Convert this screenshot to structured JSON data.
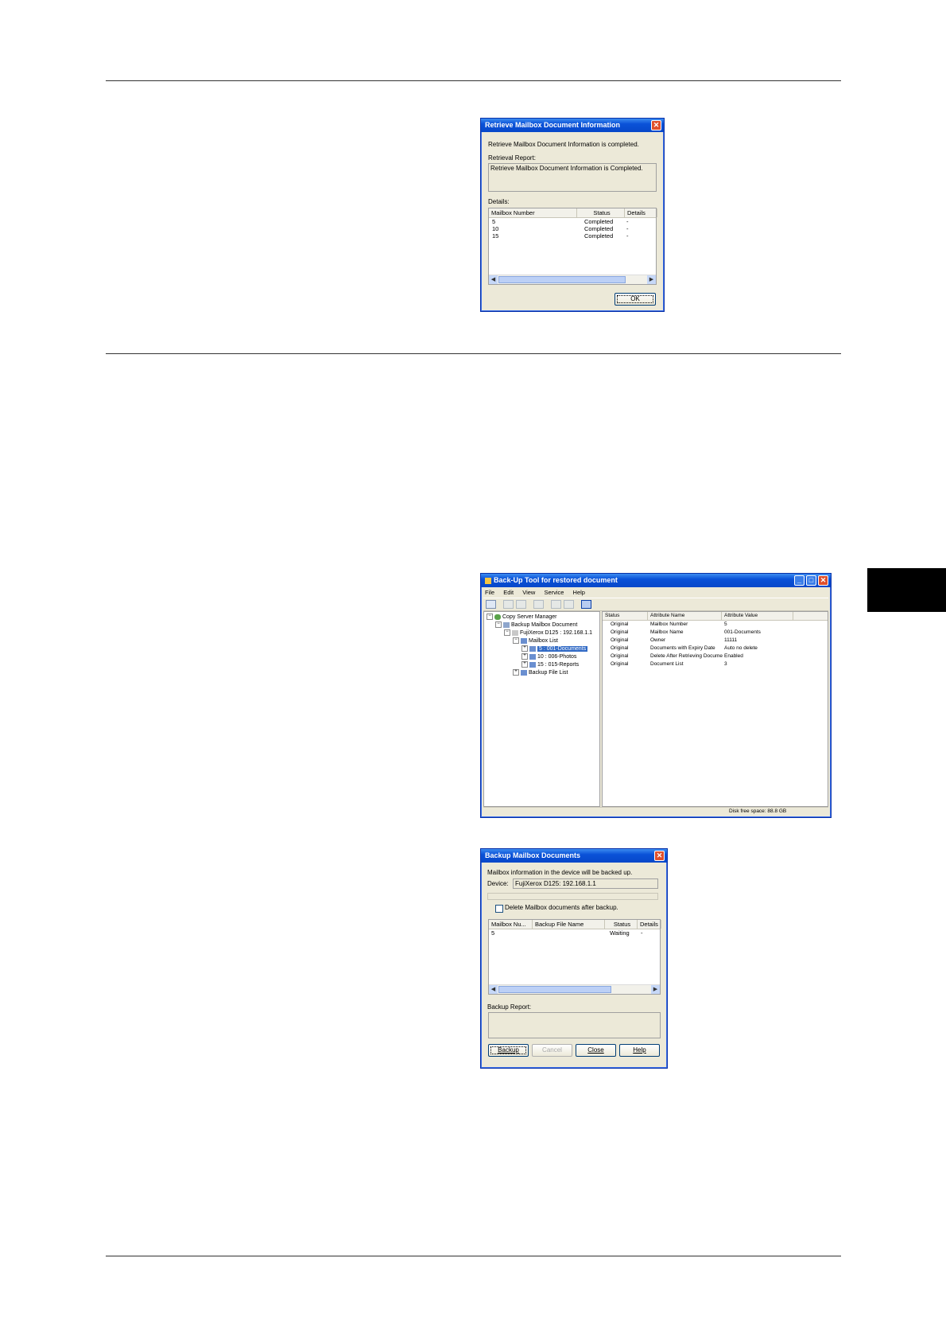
{
  "dialog1": {
    "title": "Retrieve Mailbox Document Information",
    "message": "Retrieve Mailbox Document Information is completed.",
    "report_label": "Retrieval Report:",
    "report_text": "Retrieve Mailbox Document Information is Completed.",
    "details_label": "Details:",
    "columns": [
      "Mailbox Number",
      "Status",
      "Details"
    ],
    "rows": [
      {
        "mailbox": "5",
        "status": "Completed",
        "details": "-"
      },
      {
        "mailbox": "10",
        "status": "Completed",
        "details": "-"
      },
      {
        "mailbox": "15",
        "status": "Completed",
        "details": "-"
      }
    ],
    "ok_label": "OK"
  },
  "main_window": {
    "title": "Back-Up Tool for restored document",
    "menus": [
      "File",
      "Edit",
      "View",
      "Service",
      "Help"
    ],
    "tree": {
      "root": "Copy Server Manager",
      "backup": "Backup Mailbox Document",
      "device": "FujiXerox D125 : 192.168.1.1",
      "mailbox_list": "Mailbox List",
      "mailboxes": [
        "5 : 001-Documents",
        "10 : 006-Photos",
        "15 : 015-Reports"
      ],
      "backup_file_list": "Backup File List"
    },
    "columns": [
      "Status",
      "Attribute Name",
      "Attribute Value"
    ],
    "rows": [
      {
        "status": "Original",
        "name": "Mailbox Number",
        "value": "5"
      },
      {
        "status": "Original",
        "name": "Mailbox Name",
        "value": "001-Documents"
      },
      {
        "status": "Original",
        "name": "Owner",
        "value": "11111"
      },
      {
        "status": "Original",
        "name": "Documents with Expiry Date",
        "value": "Auto no delete"
      },
      {
        "status": "Original",
        "name": "Delete After Retrieving Docume",
        "value": "Enabled"
      },
      {
        "status": "Original",
        "name": "Document List",
        "value": "3"
      }
    ],
    "status_bar": "Disk free space: 88.8 GB"
  },
  "dialog2": {
    "title": "Backup Mailbox Documents",
    "message": "Mailbox information in the device will be backed up.",
    "device_label": "Device:",
    "device_value": "FujiXerox D125: 192.168.1.1",
    "checkbox_label": "Delete Mailbox documents after backup.",
    "columns": [
      "Mailbox Nu...",
      "Backup File Name",
      "Status",
      "Details"
    ],
    "rows": [
      {
        "mailbox": "5",
        "file": "",
        "status": "Waiting",
        "details": "-"
      }
    ],
    "report_label": "Backup Report:",
    "buttons": {
      "backup": "Backup",
      "cancel": "Cancel",
      "close": "Close",
      "help": "Help"
    }
  }
}
